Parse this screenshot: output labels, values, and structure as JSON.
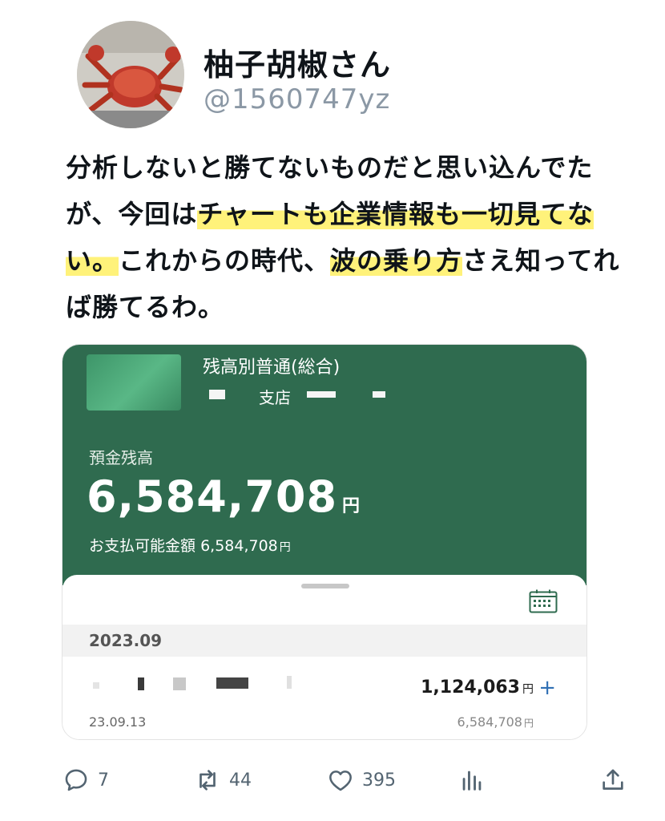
{
  "author": {
    "display_name": "柚子胡椒さん",
    "handle": "@1560747yz"
  },
  "tweet": {
    "segments": [
      {
        "text": "分析しないと勝てないものだと思い込んでたが、今回は",
        "highlight": false
      },
      {
        "text": "チャートも企業情報も一切見てない。",
        "highlight": true
      },
      {
        "text": "これからの時代、",
        "highlight": false
      },
      {
        "text": "波の乗り方",
        "highlight": true
      },
      {
        "text": "さえ知ってれば勝てるわ。",
        "highlight": false
      }
    ]
  },
  "bank_card": {
    "account_type": "残高別普通(総合)",
    "branch_label": "支店",
    "balance_label": "預金残高",
    "balance_amount": "6,584,708",
    "currency_unit": "円",
    "available_label": "お支払可能金額",
    "available_amount": "6,584,708",
    "month": "2023.09",
    "transaction": {
      "date": "23.09.13",
      "amount": "1,124,063",
      "plus": "+",
      "balance_after": "6,584,708"
    }
  },
  "actions": {
    "reply_count": "7",
    "retweet_count": "44",
    "like_count": "395"
  },
  "icons": [
    "reply-icon",
    "retweet-icon",
    "like-icon",
    "analytics-icon",
    "share-icon",
    "calendar-icon"
  ],
  "colors": {
    "card_green": "#2f6b4f",
    "highlight": "#fff27a",
    "plus_blue": "#2f6fb4"
  }
}
